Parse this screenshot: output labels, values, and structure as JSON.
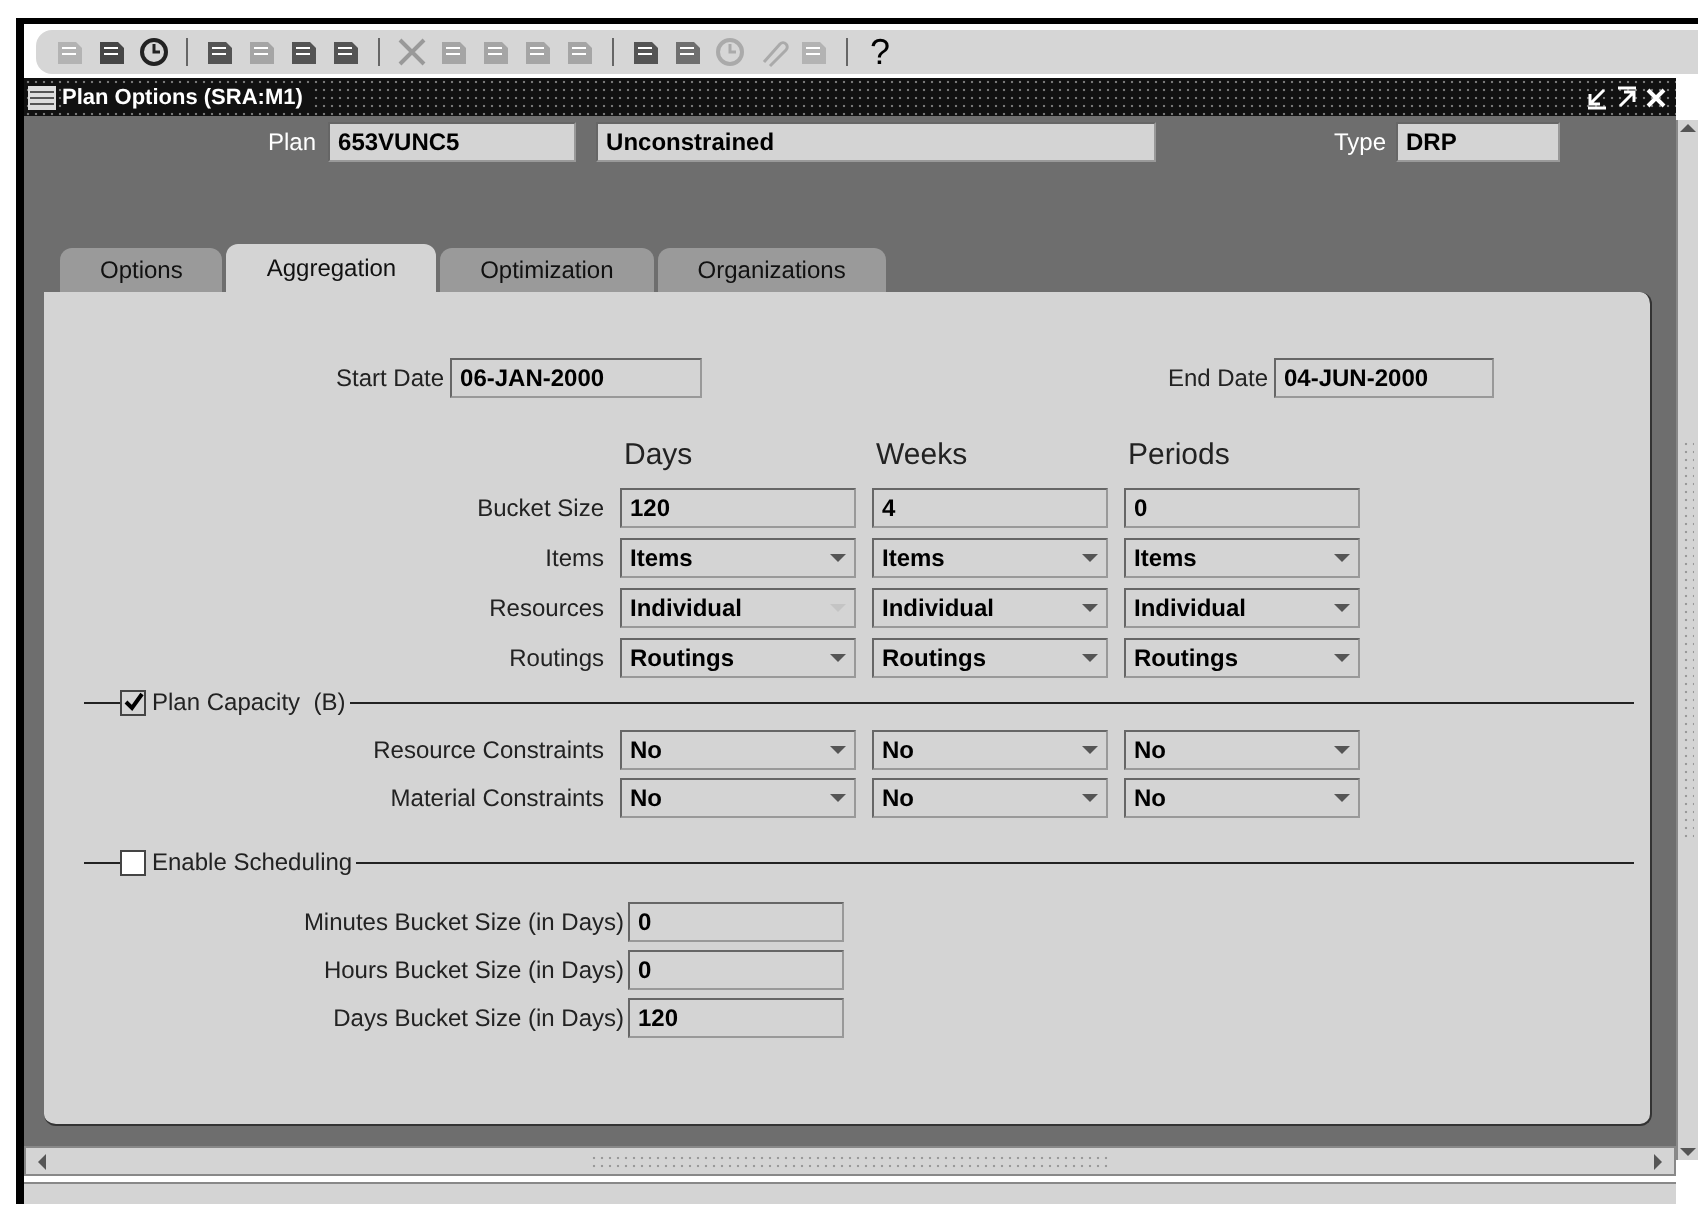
{
  "toolbar": {
    "help": "?"
  },
  "window": {
    "title": "Plan Options (SRA:M1)"
  },
  "header": {
    "plan_label": "Plan",
    "plan": "653VUNC5",
    "description": "Unconstrained",
    "type_label": "Type",
    "type": "DRP"
  },
  "tabs": [
    {
      "label": "Options",
      "selected": false
    },
    {
      "label": "Aggregation",
      "selected": true
    },
    {
      "label": "Optimization",
      "selected": false
    },
    {
      "label": "Organizations",
      "selected": false
    }
  ],
  "dates": {
    "start_label": "Start Date",
    "start": "06-JAN-2000",
    "end_label": "End Date",
    "end": "04-JUN-2000"
  },
  "columns": [
    "Days",
    "Weeks",
    "Periods"
  ],
  "rows": [
    {
      "label": "Bucket Size",
      "kind": "text",
      "cells": [
        {
          "value": "120"
        },
        {
          "value": "4"
        },
        {
          "value": "0"
        }
      ]
    },
    {
      "label": "Items",
      "kind": "select",
      "cells": [
        {
          "value": "Items",
          "disabled": false
        },
        {
          "value": "Items",
          "disabled": false
        },
        {
          "value": "Items",
          "disabled": false
        }
      ]
    },
    {
      "label": "Resources",
      "kind": "select",
      "cells": [
        {
          "value": "Individual",
          "disabled": true
        },
        {
          "value": "Individual",
          "disabled": false
        },
        {
          "value": "Individual",
          "disabled": false
        }
      ]
    },
    {
      "label": "Routings",
      "kind": "select",
      "cells": [
        {
          "value": "Routings",
          "disabled": false
        },
        {
          "value": "Routings",
          "disabled": false
        },
        {
          "value": "Routings",
          "disabled": false
        }
      ]
    }
  ],
  "plan_capacity": {
    "label": "Plan Capacity  (B)",
    "checked": true,
    "rows": [
      {
        "label": "Resource Constraints",
        "kind": "select",
        "cells": [
          {
            "value": "No",
            "disabled": false
          },
          {
            "value": "No",
            "disabled": false
          },
          {
            "value": "No",
            "disabled": false
          }
        ]
      },
      {
        "label": "Material Constraints",
        "kind": "select",
        "cells": [
          {
            "value": "No",
            "disabled": false
          },
          {
            "value": "No",
            "disabled": false
          },
          {
            "value": "No",
            "disabled": false
          }
        ]
      }
    ]
  },
  "scheduling": {
    "label": "Enable Scheduling",
    "checked": false,
    "fields": [
      {
        "label": "Minutes Bucket Size (in Days)",
        "value": "0"
      },
      {
        "label": "Hours Bucket Size (in Days)",
        "value": "0"
      },
      {
        "label": "Days Bucket Size (in Days)",
        "value": "120"
      }
    ]
  }
}
